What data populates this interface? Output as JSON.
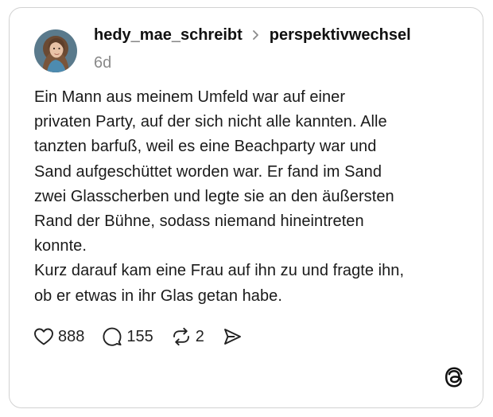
{
  "post": {
    "author": "hedy_mae_schreibt",
    "community": "perspektivwechsel",
    "time": "6d",
    "text": "Ein Mann aus meinem Umfeld war auf einer\nprivaten Party, auf der sich nicht alle kannten. Alle\ntanzten barfuß, weil es eine Beachparty war und\nSand aufgeschüttet worden war. Er fand im Sand\nzwei Glasscherben und legte sie an den äußersten\nRand der Bühne, sodass niemand hineintreten\nkonnte.\nKurz darauf kam eine Frau auf ihn zu und fragte ihn,\nob er etwas in ihr Glas getan habe."
  },
  "actions": {
    "likes": "888",
    "comments": "155",
    "reposts": "2"
  },
  "icons": {
    "like": "heart-icon",
    "comment": "comment-bubble-icon",
    "repost": "repost-icon",
    "share": "share-icon",
    "brand": "threads-logo-icon",
    "separator": "chevron-right-icon"
  }
}
